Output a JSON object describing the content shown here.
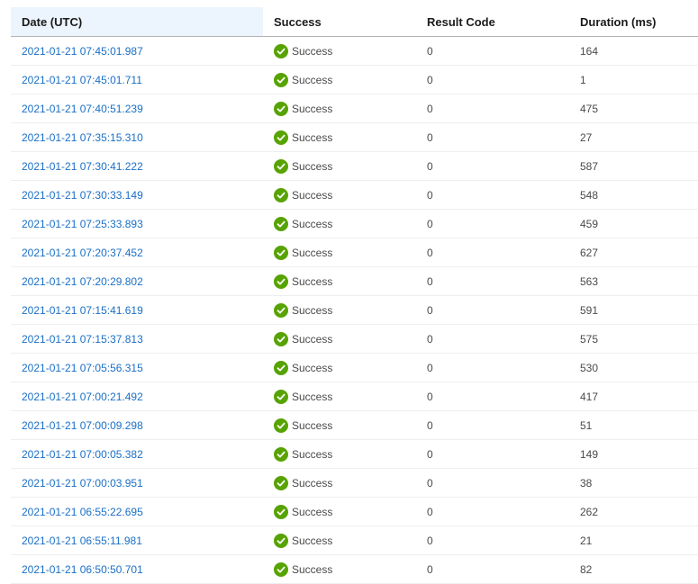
{
  "columns": {
    "date": "Date (UTC)",
    "success": "Success",
    "result_code": "Result Code",
    "duration": "Duration (ms)"
  },
  "success_color": "#57a300",
  "link_color": "#1a6fc6",
  "rows": [
    {
      "date": "2021-01-21 07:45:01.987",
      "status": "Success",
      "code": "0",
      "duration": "164"
    },
    {
      "date": "2021-01-21 07:45:01.711",
      "status": "Success",
      "code": "0",
      "duration": "1"
    },
    {
      "date": "2021-01-21 07:40:51.239",
      "status": "Success",
      "code": "0",
      "duration": "475"
    },
    {
      "date": "2021-01-21 07:35:15.310",
      "status": "Success",
      "code": "0",
      "duration": "27"
    },
    {
      "date": "2021-01-21 07:30:41.222",
      "status": "Success",
      "code": "0",
      "duration": "587"
    },
    {
      "date": "2021-01-21 07:30:33.149",
      "status": "Success",
      "code": "0",
      "duration": "548"
    },
    {
      "date": "2021-01-21 07:25:33.893",
      "status": "Success",
      "code": "0",
      "duration": "459"
    },
    {
      "date": "2021-01-21 07:20:37.452",
      "status": "Success",
      "code": "0",
      "duration": "627"
    },
    {
      "date": "2021-01-21 07:20:29.802",
      "status": "Success",
      "code": "0",
      "duration": "563"
    },
    {
      "date": "2021-01-21 07:15:41.619",
      "status": "Success",
      "code": "0",
      "duration": "591"
    },
    {
      "date": "2021-01-21 07:15:37.813",
      "status": "Success",
      "code": "0",
      "duration": "575"
    },
    {
      "date": "2021-01-21 07:05:56.315",
      "status": "Success",
      "code": "0",
      "duration": "530"
    },
    {
      "date": "2021-01-21 07:00:21.492",
      "status": "Success",
      "code": "0",
      "duration": "417"
    },
    {
      "date": "2021-01-21 07:00:09.298",
      "status": "Success",
      "code": "0",
      "duration": "51"
    },
    {
      "date": "2021-01-21 07:00:05.382",
      "status": "Success",
      "code": "0",
      "duration": "149"
    },
    {
      "date": "2021-01-21 07:00:03.951",
      "status": "Success",
      "code": "0",
      "duration": "38"
    },
    {
      "date": "2021-01-21 06:55:22.695",
      "status": "Success",
      "code": "0",
      "duration": "262"
    },
    {
      "date": "2021-01-21 06:55:11.981",
      "status": "Success",
      "code": "0",
      "duration": "21"
    },
    {
      "date": "2021-01-21 06:50:50.701",
      "status": "Success",
      "code": "0",
      "duration": "82"
    }
  ]
}
